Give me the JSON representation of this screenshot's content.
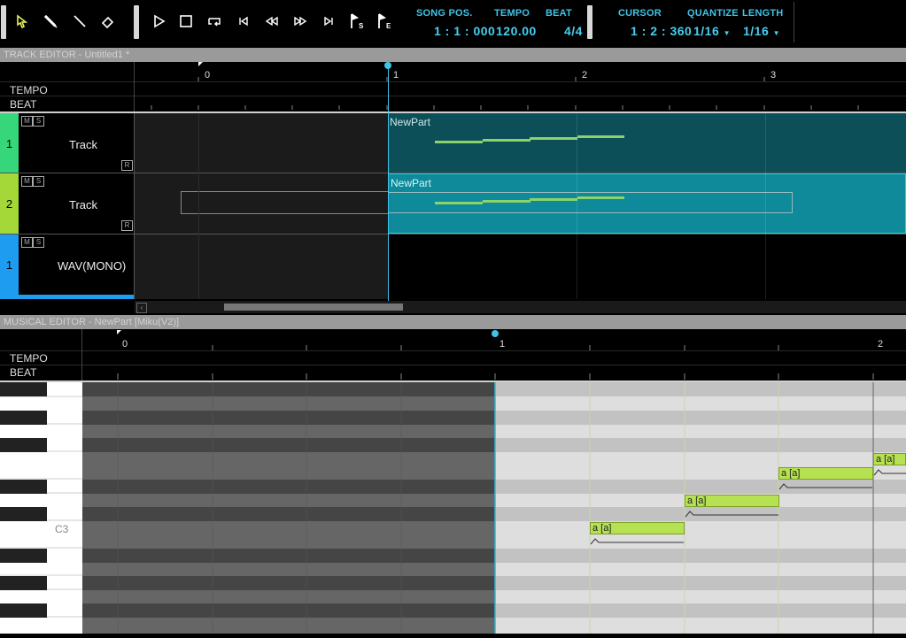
{
  "toolbar": {
    "tools": [
      "pointer-icon",
      "pencil-icon",
      "line-icon",
      "eraser-icon"
    ],
    "transport": [
      "play-icon",
      "stop-icon",
      "loop-icon",
      "go-start-icon",
      "rewind-icon",
      "fast-forward-icon",
      "go-end-icon",
      "start-marker-icon",
      "end-marker-icon"
    ],
    "song_pos_label": "SONG POS.",
    "song_pos_value": "1 : 1 : 000",
    "tempo_label": "TEMPO",
    "tempo_value": "120.00",
    "beat_label": "BEAT",
    "beat_value": "4/4",
    "cursor_label": "CURSOR",
    "cursor_value": "1 : 2 : 360",
    "quantize_label": "QUANTIZE",
    "quantize_value": "1/16",
    "length_label": "LENGTH",
    "length_value": "1/16",
    "marker_s": "S",
    "marker_e": "E"
  },
  "track_editor": {
    "title": "TRACK EDITOR - Untitled1 *",
    "tempo_label": "TEMPO",
    "beat_label": "BEAT",
    "measures": [
      "0",
      "1",
      "2",
      "3"
    ],
    "tracks": [
      {
        "number": "1",
        "name": "Track",
        "color": "#36d67a",
        "part": "NewPart"
      },
      {
        "number": "2",
        "name": "Track",
        "color": "#a4d838",
        "part": "NewPart"
      },
      {
        "number": "1",
        "name": "WAV(MONO)",
        "color": "#1e9cf0",
        "part": ""
      }
    ],
    "m": "M",
    "s": "S",
    "r": "R"
  },
  "musical_editor": {
    "title": "MUSICAL EDITOR - NewPart [Miku(V2)]",
    "tempo_label": "TEMPO",
    "beat_label": "BEAT",
    "measures": [
      "0",
      "1",
      "2"
    ],
    "c3_label": "C3",
    "notes": [
      {
        "lyric": "a [a]"
      },
      {
        "lyric": "a [a]"
      },
      {
        "lyric": "a [a]"
      },
      {
        "lyric": "a [a]"
      }
    ]
  },
  "colors": {
    "accent": "#3fc3e6",
    "part_fill": "#0e8a9a",
    "note_fill": "#b6e152"
  }
}
